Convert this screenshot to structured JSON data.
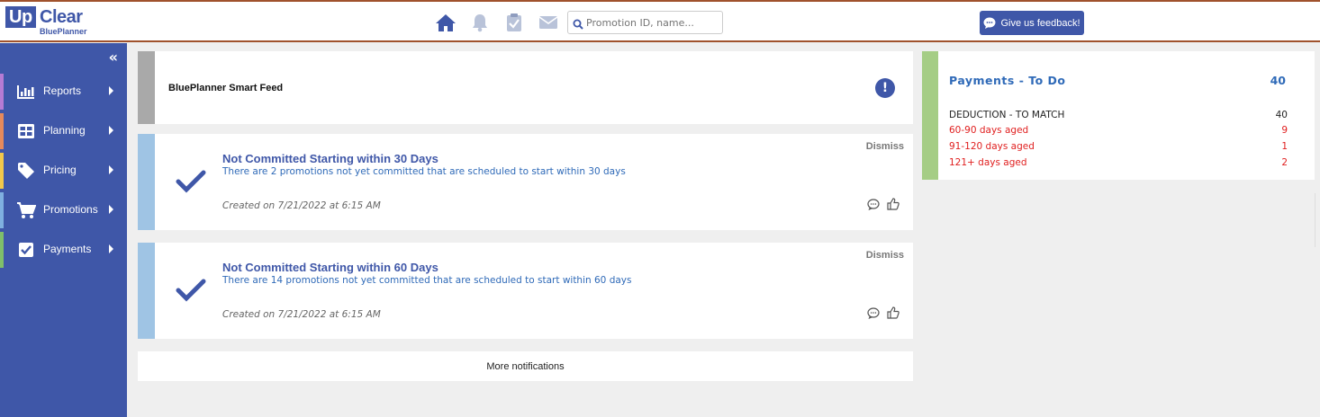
{
  "header": {
    "logo_main_a": "Up",
    "logo_main_b": "Clear",
    "logo_sub": "BluePlanner",
    "search_placeholder": "Promotion ID, name...",
    "feedback_label": "Give us feedback!",
    "icons": [
      "home-icon",
      "bell-icon",
      "clipboard-check-icon",
      "mail-icon",
      "search-icon"
    ]
  },
  "sidebar": {
    "collapse": "«",
    "items": [
      {
        "label": "Reports",
        "icon": "bar-chart-icon",
        "color": "#b57bd4"
      },
      {
        "label": "Planning",
        "icon": "grid-icon",
        "color": "#e58a5c"
      },
      {
        "label": "Pricing",
        "icon": "tag-icon",
        "color": "#f1c84b"
      },
      {
        "label": "Promotions",
        "icon": "cart-icon",
        "color": "#7fb0e0"
      },
      {
        "label": "Payments",
        "icon": "checkbox-icon",
        "color": "#7fbf6a"
      }
    ]
  },
  "feed": {
    "title": "BluePlanner Smart Feed",
    "alert": "!",
    "notifications": [
      {
        "title": "Not Committed Starting within 30 Days",
        "desc": "There are 2 promotions not yet committed that are scheduled to start within 30 days",
        "date": "Created on 7/21/2022 at 6:15 AM",
        "dismiss": "Dismiss"
      },
      {
        "title": "Not Committed Starting within 60 Days",
        "desc": "There are 14 promotions not yet committed that are scheduled to start within 60 days",
        "date": "Created on 7/21/2022 at 6:15 AM",
        "dismiss": "Dismiss"
      }
    ],
    "more": "More notifications"
  },
  "payments": {
    "title": "Payments - To Do",
    "count": "40",
    "rows": [
      {
        "label": "DEDUCTION - TO MATCH",
        "value": "40",
        "color": "#222222"
      },
      {
        "label": "60-90 days aged",
        "value": "9",
        "color": "#e02020"
      },
      {
        "label": "91-120 days aged",
        "value": "1",
        "color": "#e02020"
      },
      {
        "label": "121+ days aged",
        "value": "2",
        "color": "#e02020"
      }
    ]
  },
  "colors": {
    "brand": "#3f57a8",
    "link": "#2f6ab8",
    "feed_bar": "#a9a9a9",
    "notif_bar": "#9fc4e4",
    "pay_bar": "#a5cd85",
    "top_border": "#a0522d"
  }
}
